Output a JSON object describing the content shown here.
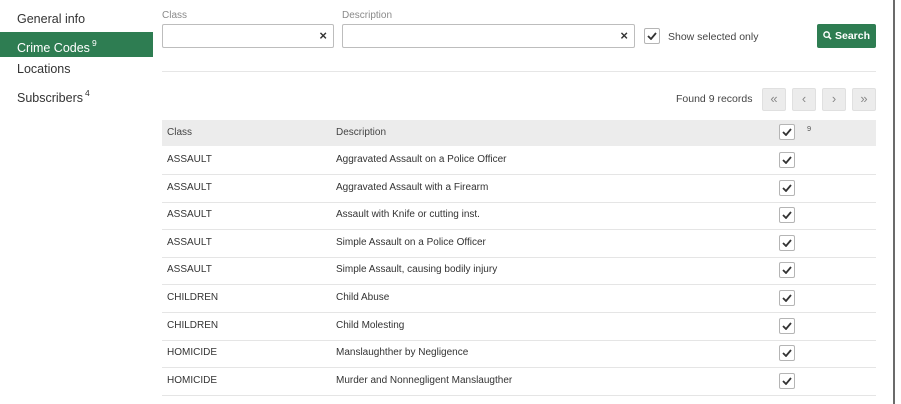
{
  "sidebar": {
    "items": [
      {
        "label": "General info",
        "badge": ""
      },
      {
        "label": "Crime Codes",
        "badge": "9",
        "active": true
      },
      {
        "label": "Locations",
        "badge": ""
      },
      {
        "label": "Subscribers",
        "badge": "4"
      }
    ]
  },
  "filters": {
    "class_label": "Class",
    "class_value": "",
    "description_label": "Description",
    "description_value": "",
    "clear_icon": "close-icon",
    "show_selected_label": "Show selected only",
    "show_selected_checked": true,
    "search_label": "Search",
    "search_icon": "search-icon"
  },
  "pager": {
    "found_text": "Found 9 records",
    "first": "«",
    "prev": "‹",
    "next": "›",
    "last": "»"
  },
  "table": {
    "headers": {
      "class": "Class",
      "description": "Description"
    },
    "selected_count": "9",
    "rows": [
      {
        "class": "ASSAULT",
        "description": "Aggravated Assault on a Police Officer",
        "checked": true
      },
      {
        "class": "ASSAULT",
        "description": "Aggravated Assault with a Firearm",
        "checked": true
      },
      {
        "class": "ASSAULT",
        "description": "Assault with Knife or cutting inst.",
        "checked": true
      },
      {
        "class": "ASSAULT",
        "description": "Simple Assault on a Police Officer",
        "checked": true
      },
      {
        "class": "ASSAULT",
        "description": "Simple Assault, causing bodily injury",
        "checked": true
      },
      {
        "class": "CHILDREN",
        "description": "Child Abuse",
        "checked": true
      },
      {
        "class": "CHILDREN",
        "description": "Child Molesting",
        "checked": true
      },
      {
        "class": "HOMICIDE",
        "description": "Manslaughther by Negligence",
        "checked": true
      },
      {
        "class": "HOMICIDE",
        "description": "Murder and Nonnegligent Manslaugther",
        "checked": true
      }
    ]
  },
  "colors": {
    "accent": "#2e7d52",
    "header_bg": "#ececec"
  }
}
